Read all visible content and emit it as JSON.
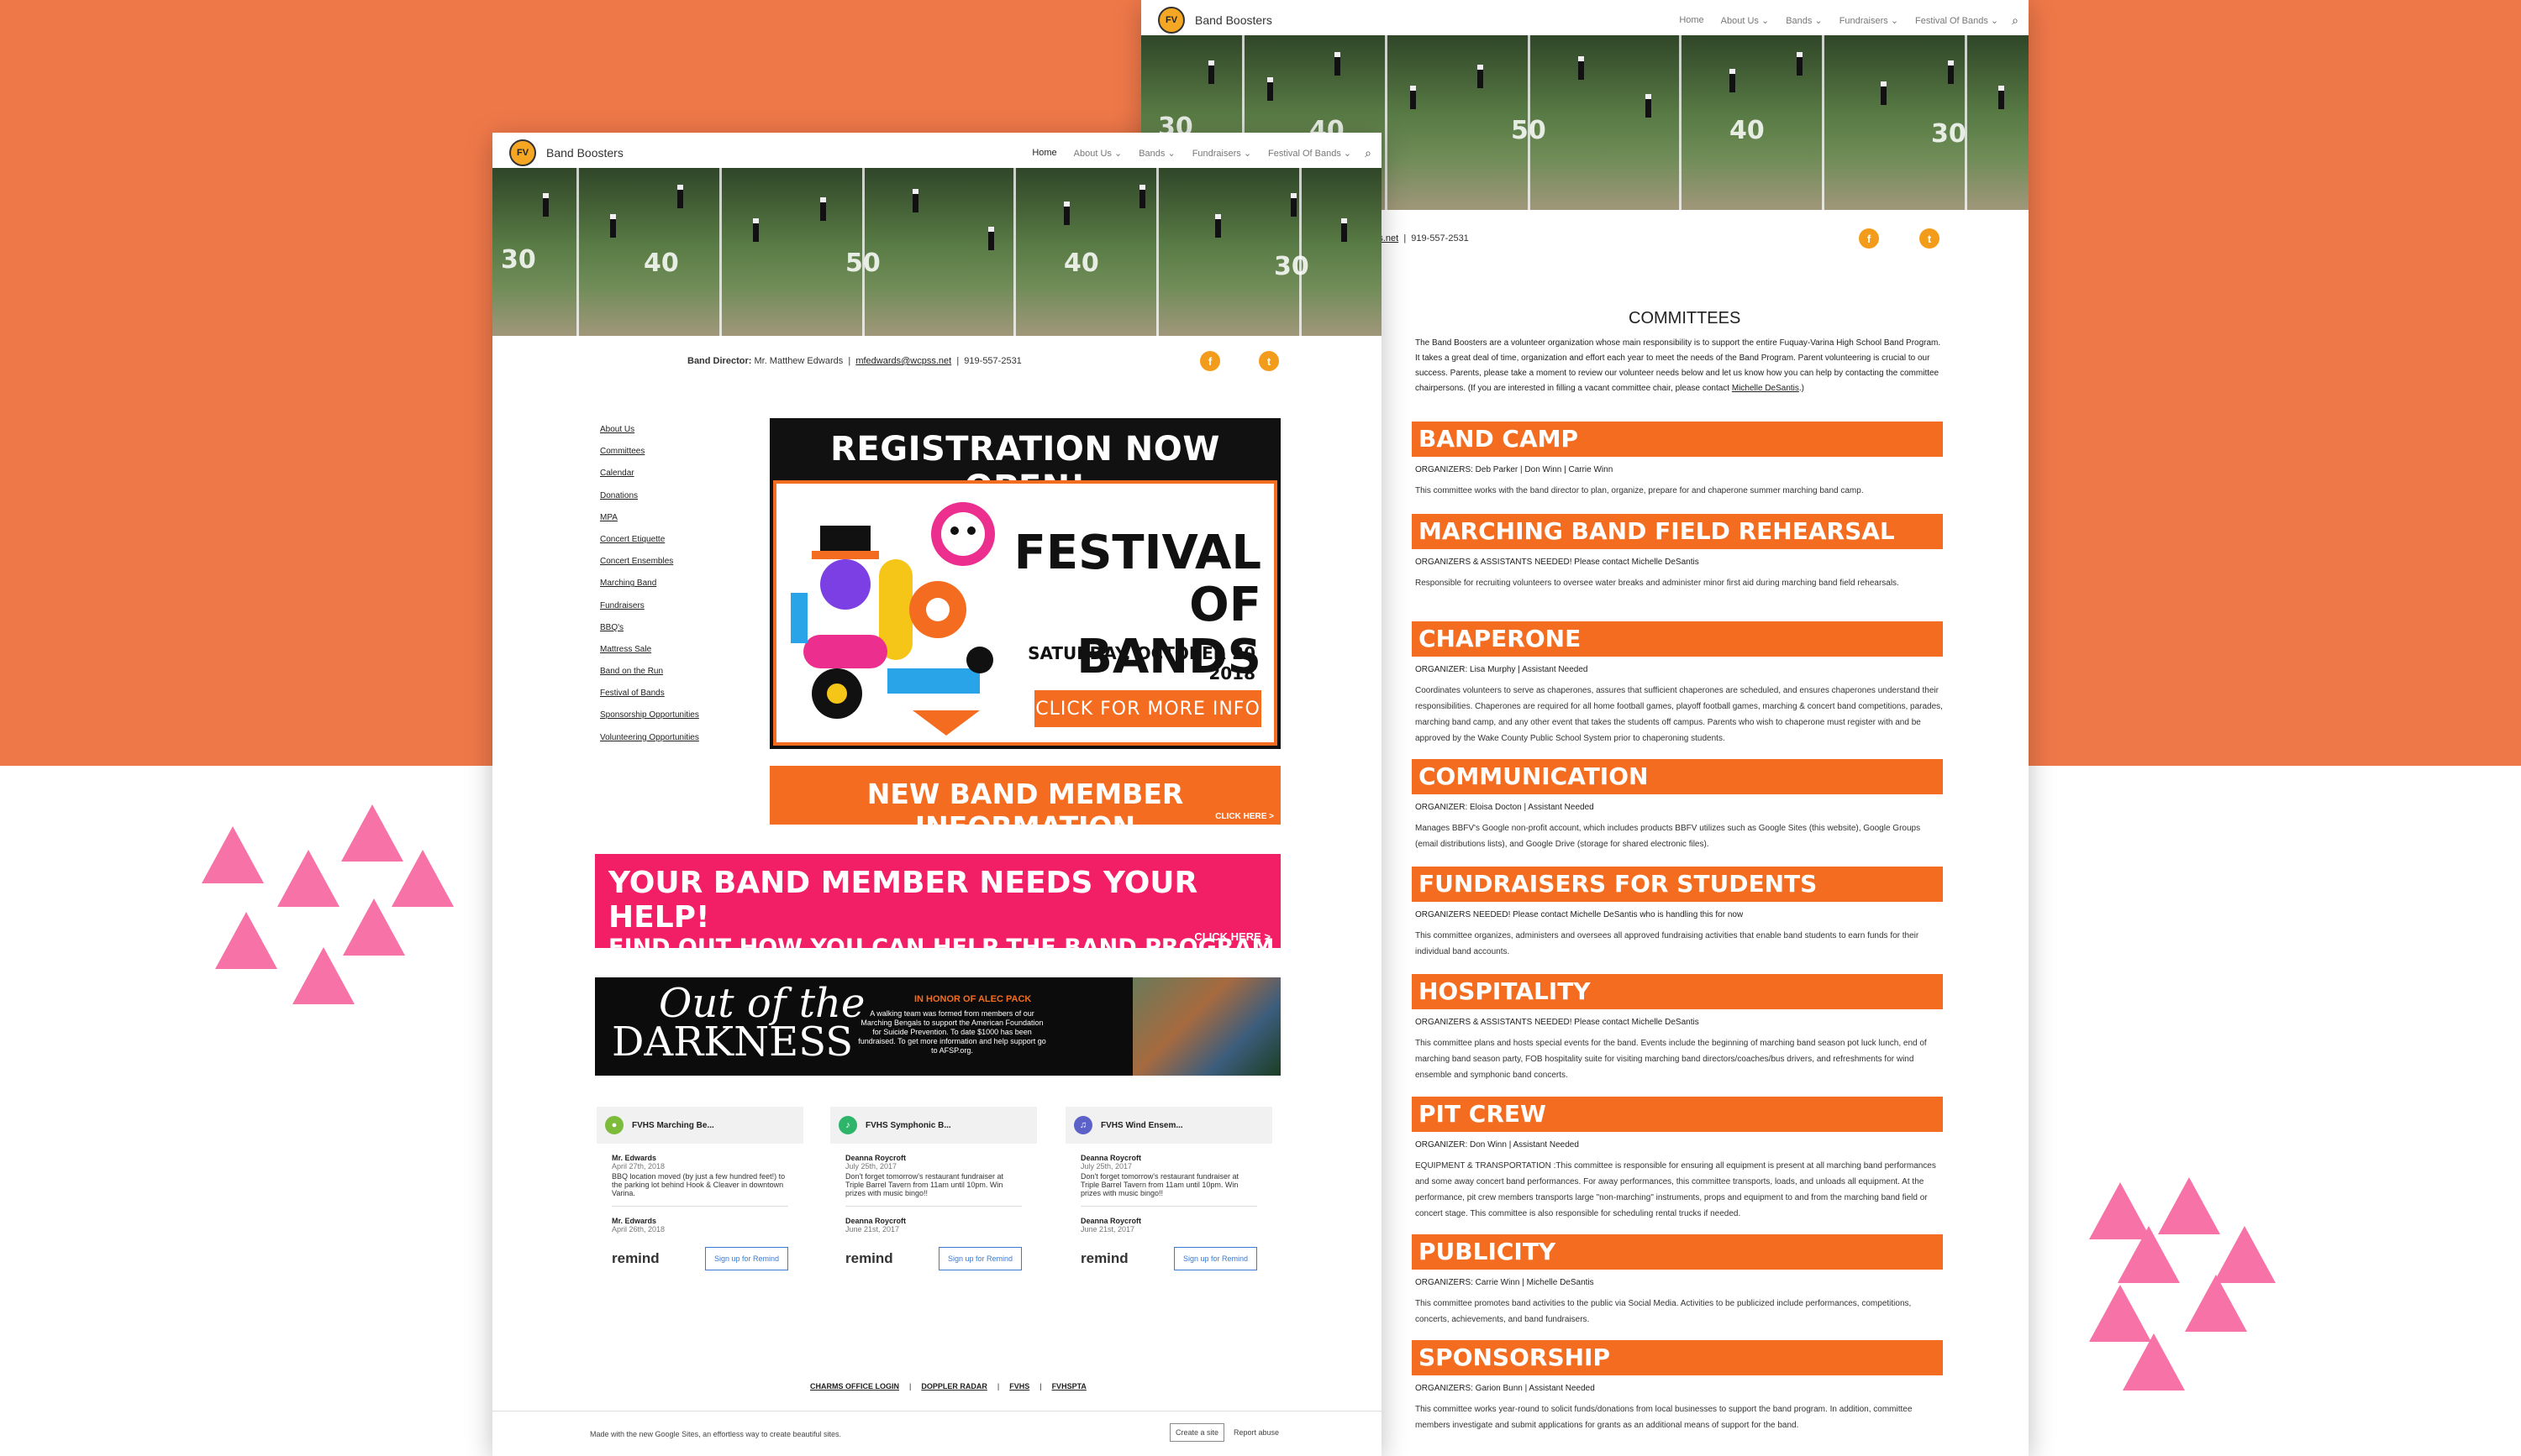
{
  "site": {
    "title": "Band Boosters",
    "logo_text": "FV"
  },
  "nav": {
    "home": "Home",
    "about": "About Us",
    "bands": "Bands",
    "fundraisers": "Fundraisers",
    "festival": "Festival Of Bands"
  },
  "contact": {
    "label": "Band Director:",
    "name": "Mr. Matthew Edwards",
    "email": "mfedwards@wcpss.net",
    "phone": "919-557-2531"
  },
  "social": {
    "facebook": "f",
    "twitter": "t"
  },
  "hero_numbers": [
    "30",
    "40",
    "50",
    "40",
    "30"
  ],
  "sidebar": [
    "About Us",
    "Committees",
    "Calendar",
    "Donations",
    "MPA",
    "Concert Etiquette",
    "Concert Ensembles",
    "Marching Band",
    "Fundraisers",
    "BBQ's",
    "Mattress Sale",
    "Band on the Run",
    "Festival of Bands",
    "Sponsorship Opportunities",
    "Volunteering Opportunities"
  ],
  "banners": {
    "registration": "REGISTRATION NOW OPEN!",
    "festival_line1": "FESTIVAL",
    "festival_line2": "OF BANDS",
    "festival_date": "SATURDAY, OCTOBER 20 2018",
    "festival_button": "CLICK FOR MORE INFO",
    "new_member": "NEW BAND MEMBER INFORMATION",
    "click_here": "CLICK HERE >",
    "help_title": "YOUR BAND MEMBER NEEDS YOUR HELP!",
    "help_sub": "FIND OUT HOW YOU CAN HELP THE BAND PROGRAM",
    "help_click": "CLICK HERE >",
    "ootd_line1": "Out of the",
    "ootd_line2": "DARKNESS",
    "ootd_honor": "IN HONOR OF ALEC PACK",
    "ootd_text": "A walking team was formed from members of our Marching Bengals to support the American Foundation for Suicide Prevention. To date $1000 has been fundraised. To get more information and help support go to AFSP.org."
  },
  "cards": [
    {
      "name": "FVHS Marching Be...",
      "color": "#7dbb3a",
      "e1_author": "Mr. Edwards",
      "e1_date": "April 27th, 2018",
      "e1_text": "BBQ location moved (by just a few hundred feet!) to the parking lot behind Hook & Cleaver in downtown Varina.",
      "e2_author": "Mr. Edwards",
      "e2_date": "April 26th, 2018"
    },
    {
      "name": "FVHS Symphonic B...",
      "color": "#2db56a",
      "e1_author": "Deanna Roycroft",
      "e1_date": "July 25th, 2017",
      "e1_text": "Don't forget tomorrow's restaurant fundraiser at Triple Barrel Tavern from 11am until 10pm. Win prizes with music bingo!!",
      "e2_author": "Deanna Roycroft",
      "e2_date": "June 21st, 2017"
    },
    {
      "name": "FVHS Wind Ensem...",
      "color": "#5b61c9",
      "e1_author": "Deanna Roycroft",
      "e1_date": "July 25th, 2017",
      "e1_text": "Don't forget tomorrow's restaurant fundraiser at Triple Barrel Tavern from 11am until 10pm. Win prizes with music bingo!!",
      "e2_author": "Deanna Roycroft",
      "e2_date": "June 21st, 2017"
    }
  ],
  "remind": {
    "logo": "remind",
    "signup": "Sign up for Remind"
  },
  "footer_links": [
    "CHARMS OFFICE LOGIN",
    "DOPPLER RADAR",
    "FVHS",
    "FVHSPTA"
  ],
  "google_footer": {
    "text": "Made with the new Google Sites, an effortless way to create beautiful sites.",
    "create": "Create a site",
    "report": "Report abuse"
  },
  "committees": {
    "title": "COMMITTEES",
    "intro": "The Band Boosters are a volunteer organization whose main responsibility is to support the entire Fuquay-Varina High School Band Program. It takes a great deal of time, organization and effort each year to meet the needs of the Band Program. Parent volunteering is crucial to our success. Parents, please take a moment to review our volunteer needs below and let us know how you can help by contacting the committee chairpersons. (If you are interested in filling a vacant committee chair, please contact",
    "intro_link": "Michelle DeSantis",
    "intro_end": ".)",
    "sections": [
      {
        "name": "BAND CAMP",
        "org": "ORGANIZERS: Deb Parker | Don Winn | Carrie Winn",
        "desc": "This committee works with the band director to plan, organize, prepare for and chaperone summer marching band camp."
      },
      {
        "name": "MARCHING BAND FIELD REHEARSAL",
        "org": "ORGANIZERS & ASSISTANTS NEEDED! Please contact Michelle DeSantis",
        "desc": "Responsible for recruiting volunteers to oversee water breaks and administer minor first aid during marching band field rehearsals."
      },
      {
        "name": "CHAPERONE",
        "org": "ORGANIZER: Lisa Murphy | Assistant Needed",
        "desc": "Coordinates volunteers to serve as chaperones, assures that sufficient chaperones are scheduled, and ensures chaperones understand their responsibilities. Chaperones are required for all home football games, playoff football games, marching & concert band competitions, parades, marching band camp, and any other event that takes the students off campus. Parents who wish to chaperone must register with and be approved by the Wake County Public School System prior to chaperoning students."
      },
      {
        "name": "COMMUNICATION",
        "org": "ORGANIZER: Eloisa Docton | Assistant Needed",
        "desc": "Manages BBFV's Google non-profit account, which includes products BBFV utilizes such as Google Sites (this website), Google Groups (email distributions lists), and Google Drive (storage for shared electronic files)."
      },
      {
        "name": "FUNDRAISERS FOR STUDENTS",
        "org": "ORGANIZERS NEEDED! Please contact Michelle DeSantis who is handling this for now",
        "desc": "This committee organizes, administers and oversees all approved fundraising activities that enable band students to earn funds for their individual band accounts."
      },
      {
        "name": "HOSPITALITY",
        "org": "ORGANIZERS & ASSISTANTS NEEDED! Please contact Michelle DeSantis",
        "desc": "This committee plans and hosts special events for the band. Events include the beginning of marching band season pot luck lunch, end of marching band season party, FOB hospitality suite for visiting marching band directors/coaches/bus drivers, and refreshments for wind ensemble and symphonic band concerts."
      },
      {
        "name": "PIT CREW",
        "org": "ORGANIZER: Don Winn | Assistant Needed",
        "desc": "EQUIPMENT & TRANSPORTATION :This committee is responsible for ensuring all equipment is present at all marching band performances and some away concert band performances. For away performances, this committee transports, loads, and unloads all equipment. At the performance, pit crew members transports large \"non-marching\" instruments, props and equipment to and from the marching band field or concert stage. This committee is also responsible for scheduling rental trucks if needed."
      },
      {
        "name": "PUBLICITY",
        "org": "ORGANIZERS: Carrie Winn | Michelle DeSantis",
        "desc": "This committee promotes band activities to the public via Social Media. Activities to be publicized include performances, competitions, concerts, achievements, and band fundraisers."
      },
      {
        "name": "SPONSORSHIP",
        "org": "ORGANIZERS: Garion Bunn | Assistant Needed",
        "desc": "This committee works year-round to solicit funds/donations from local businesses to support the band program. In addition, committee members investigate and submit applications for grants as an additional means of support for the band."
      }
    ]
  },
  "colors": {
    "orange_bg": "#ef7849",
    "accent": "#f36c1f",
    "pink": "#f772a7",
    "help_pink": "#f31f66",
    "social": "#f39c1b"
  }
}
